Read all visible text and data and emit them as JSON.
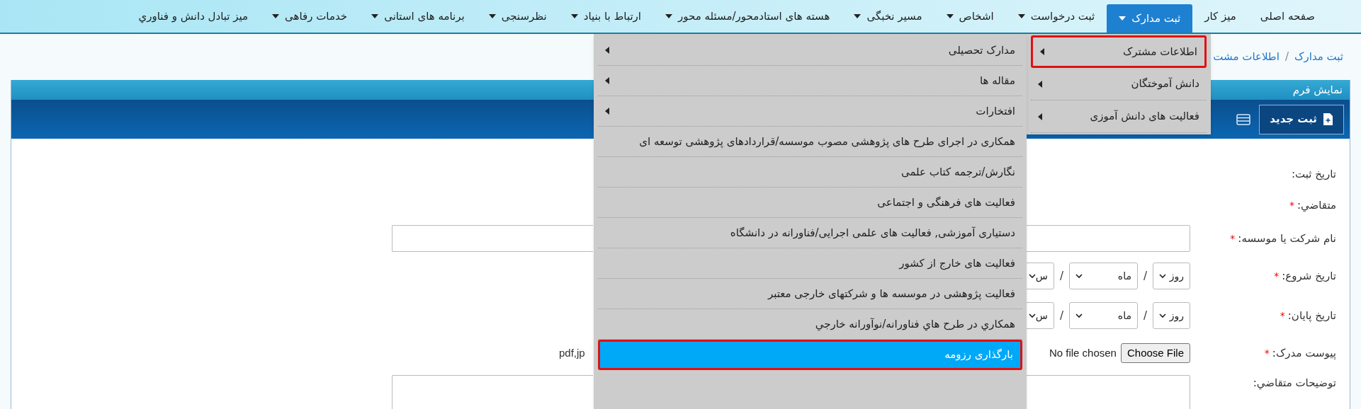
{
  "nav": [
    {
      "label": "صفحه اصلی",
      "dropdown": false,
      "selected": false
    },
    {
      "label": "میز کار",
      "dropdown": false,
      "selected": false
    },
    {
      "label": "ثبت مدارک",
      "dropdown": true,
      "selected": true
    },
    {
      "label": "ثبت درخواست",
      "dropdown": true,
      "selected": false
    },
    {
      "label": "اشخاص",
      "dropdown": true,
      "selected": false
    },
    {
      "label": "مسیر نخبگی",
      "dropdown": true,
      "selected": false
    },
    {
      "label": "هسته های استادمحور/مسئله محور",
      "dropdown": true,
      "selected": false
    },
    {
      "label": "ارتباط با بنیاد",
      "dropdown": true,
      "selected": false
    },
    {
      "label": "نظرسنجی",
      "dropdown": true,
      "selected": false
    },
    {
      "label": "برنامه های استانی",
      "dropdown": true,
      "selected": false
    },
    {
      "label": "خدمات رفاهی",
      "dropdown": true,
      "selected": false
    },
    {
      "label": "میز تبادل دانش و فناوري",
      "dropdown": false,
      "selected": false
    }
  ],
  "breadcrumb": {
    "items": [
      "ثبت مدارک",
      "اطلاعات مشت"
    ],
    "separator": "/"
  },
  "required_mark": "*",
  "date_separator": "/",
  "panel": {
    "title": "نمایش فرم",
    "new_button": "ثبت جدید"
  },
  "form": {
    "fields": [
      {
        "kind": "static",
        "label": "تاریخ ثبت:",
        "required": false
      },
      {
        "kind": "static",
        "label": "متقاضي:",
        "required": true
      },
      {
        "kind": "text",
        "label": "نام شرکت یا موسسه:",
        "required": true
      },
      {
        "kind": "date",
        "label": "تاریخ شروع:",
        "required": true,
        "day": "روز",
        "month": "ماه",
        "year": "س"
      },
      {
        "kind": "date",
        "label": "تاریخ پایان:",
        "required": true,
        "day": "روز",
        "month": "ماه",
        "year": "س"
      },
      {
        "kind": "file",
        "label": "پیوست مدرک:",
        "required": true,
        "button": "Choose File",
        "status": "No file chosen",
        "hint": "pdf,jp"
      },
      {
        "kind": "textarea",
        "label": "توضیحات متقاضي:",
        "required": false
      }
    ]
  },
  "menu": {
    "level1": [
      {
        "label": "اطلاعات مشترک",
        "has_submenu": true,
        "selected": true
      },
      {
        "label": "دانش آموختگان",
        "has_submenu": true,
        "selected": false
      },
      {
        "label": "فعالیت های دانش آموزی",
        "has_submenu": true,
        "selected": false
      }
    ],
    "level2": [
      {
        "label": "مدارک تحصیلی",
        "has_submenu": true,
        "selected": false,
        "highlighted": false
      },
      {
        "label": "مقاله ها",
        "has_submenu": true,
        "selected": false,
        "highlighted": false
      },
      {
        "label": "افتخارات",
        "has_submenu": true,
        "selected": false,
        "highlighted": false
      },
      {
        "label": "همکاری در اجرای طرح های پژوهشی مصوب موسسه/قراردادهای پژوهشی توسعه ای",
        "has_submenu": false,
        "selected": false,
        "highlighted": false
      },
      {
        "label": "نگارش/ترجمه کتاب علمی",
        "has_submenu": false,
        "selected": false,
        "highlighted": false
      },
      {
        "label": "فعالیت های فرهنگی و اجتماعی",
        "has_submenu": false,
        "selected": false,
        "highlighted": false
      },
      {
        "label": "دستیاری آموزشی, فعالیت های علمی اجرایی/فناورانه در دانشگاه",
        "has_submenu": false,
        "selected": false,
        "highlighted": false
      },
      {
        "label": "فعالیت های خارج از کشور",
        "has_submenu": false,
        "selected": false,
        "highlighted": false
      },
      {
        "label": "فعالیت پژوهشی در موسسه ها و شرکتهای خارجی معتبر",
        "has_submenu": false,
        "selected": false,
        "highlighted": false
      },
      {
        "label": "همكاري در طرح هاي فناورانه/نوآورانه خارجي",
        "has_submenu": false,
        "selected": false,
        "highlighted": false
      },
      {
        "label": "بارگذاری رزومه",
        "has_submenu": false,
        "selected": true,
        "highlighted": true
      }
    ]
  }
}
